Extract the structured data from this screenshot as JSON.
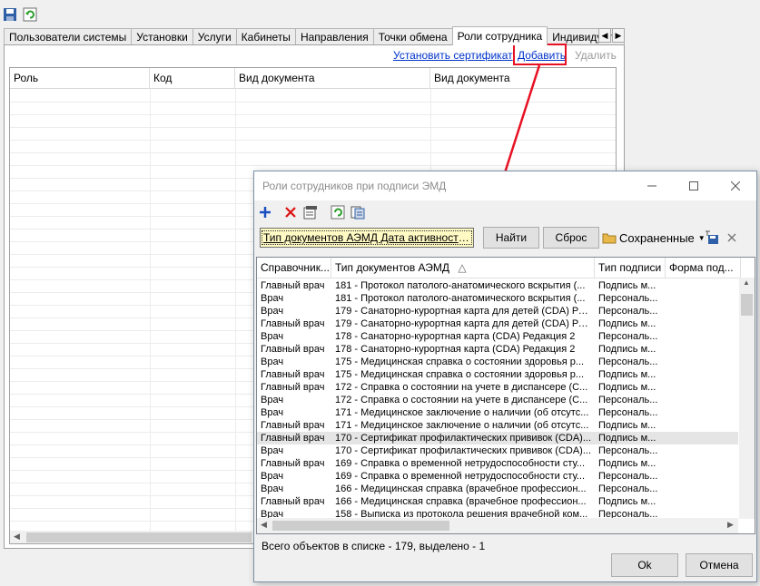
{
  "toolbar": {
    "save_icon": "save-icon",
    "refresh_icon": "refresh-icon"
  },
  "tabs": [
    {
      "label": "Пользователи системы"
    },
    {
      "label": "Установки"
    },
    {
      "label": "Услуги"
    },
    {
      "label": "Кабинеты"
    },
    {
      "label": "Направления"
    },
    {
      "label": "Точки обмена"
    },
    {
      "label": "Роли сотрудника"
    },
    {
      "label": "Индивидуальн"
    }
  ],
  "actions": {
    "install_cert": "Установить сертификат",
    "add": "Добавить",
    "delete": "Удалить"
  },
  "grid": {
    "columns": [
      "Роль",
      "Код",
      "Вид документа",
      "Вид документа"
    ]
  },
  "dialog": {
    "title": "Роли сотрудников при подписи ЭМД",
    "filter_text": "Тип документов АЭМД Дата активности с...",
    "find": "Найти",
    "reset": "Сброс",
    "saved": "Сохраненные",
    "columns": [
      "Справочник...",
      "Тип документов АЭМД",
      "Тип подписи",
      "Форма под..."
    ],
    "rows": [
      {
        "role": "Главный врач",
        "doc": "181 - Протокол патолого-анатомического вскрытия (...",
        "sign": "Подпись м..."
      },
      {
        "role": "Врач",
        "doc": "181 - Протокол патолого-анатомического вскрытия (...",
        "sign": "Персональ..."
      },
      {
        "role": "Врач",
        "doc": "179 - Санаторно-курортная карта для детей (CDA) Ре...",
        "sign": "Персональ..."
      },
      {
        "role": "Главный врач",
        "doc": "179 - Санаторно-курортная карта для детей (CDA) Ре...",
        "sign": "Подпись м..."
      },
      {
        "role": "Врач",
        "doc": "178 - Санаторно-курортная карта (CDA) Редакция 2",
        "sign": "Персональ..."
      },
      {
        "role": "Главный врач",
        "doc": "178 - Санаторно-курортная карта (CDA) Редакция 2",
        "sign": "Подпись м..."
      },
      {
        "role": "Врач",
        "doc": "175 - Медицинская справка о состоянии здоровья р...",
        "sign": "Персональ..."
      },
      {
        "role": "Главный врач",
        "doc": "175 - Медицинская справка о состоянии здоровья р...",
        "sign": "Подпись м..."
      },
      {
        "role": "Главный врач",
        "doc": "172 - Справка о состоянии на учете в диспансере (С...",
        "sign": "Подпись м..."
      },
      {
        "role": "Врач",
        "doc": "172 - Справка о состоянии на учете в диспансере (С...",
        "sign": "Персональ..."
      },
      {
        "role": "Врач",
        "doc": "171 - Медицинское заключение о наличии (об отсутс...",
        "sign": "Персональ..."
      },
      {
        "role": "Главный врач",
        "doc": "171 - Медицинское заключение о наличии (об отсутс...",
        "sign": "Подпись м..."
      },
      {
        "role": "Главный врач",
        "doc": "170 - Сертификат профилактических прививок (CDA)...",
        "sign": "Подпись м..."
      },
      {
        "role": "Врач",
        "doc": "170 - Сертификат профилактических прививок (CDA)...",
        "sign": "Персональ..."
      },
      {
        "role": "Главный врач",
        "doc": "169 - Справка о временной нетрудоспособности сту...",
        "sign": "Подпись м..."
      },
      {
        "role": "Врач",
        "doc": "169 - Справка о временной нетрудоспособности сту...",
        "sign": "Персональ..."
      },
      {
        "role": "Врач",
        "doc": "166 - Медицинская справка (врачебное профессион...",
        "sign": "Персональ..."
      },
      {
        "role": "Главный врач",
        "doc": "166 - Медицинская справка (врачебное профессион...",
        "sign": "Подпись м..."
      },
      {
        "role": "Врач",
        "doc": "158 - Выписка из протокола решения врачебной ком...",
        "sign": "Персональ..."
      }
    ],
    "status": "Всего объектов в списке - 179, выделено - 1",
    "ok": "Ok",
    "cancel": "Отмена"
  },
  "colors": {
    "highlight_red": "#e81123",
    "link_blue": "#0033cc",
    "filter_bg": "#fffac4"
  }
}
